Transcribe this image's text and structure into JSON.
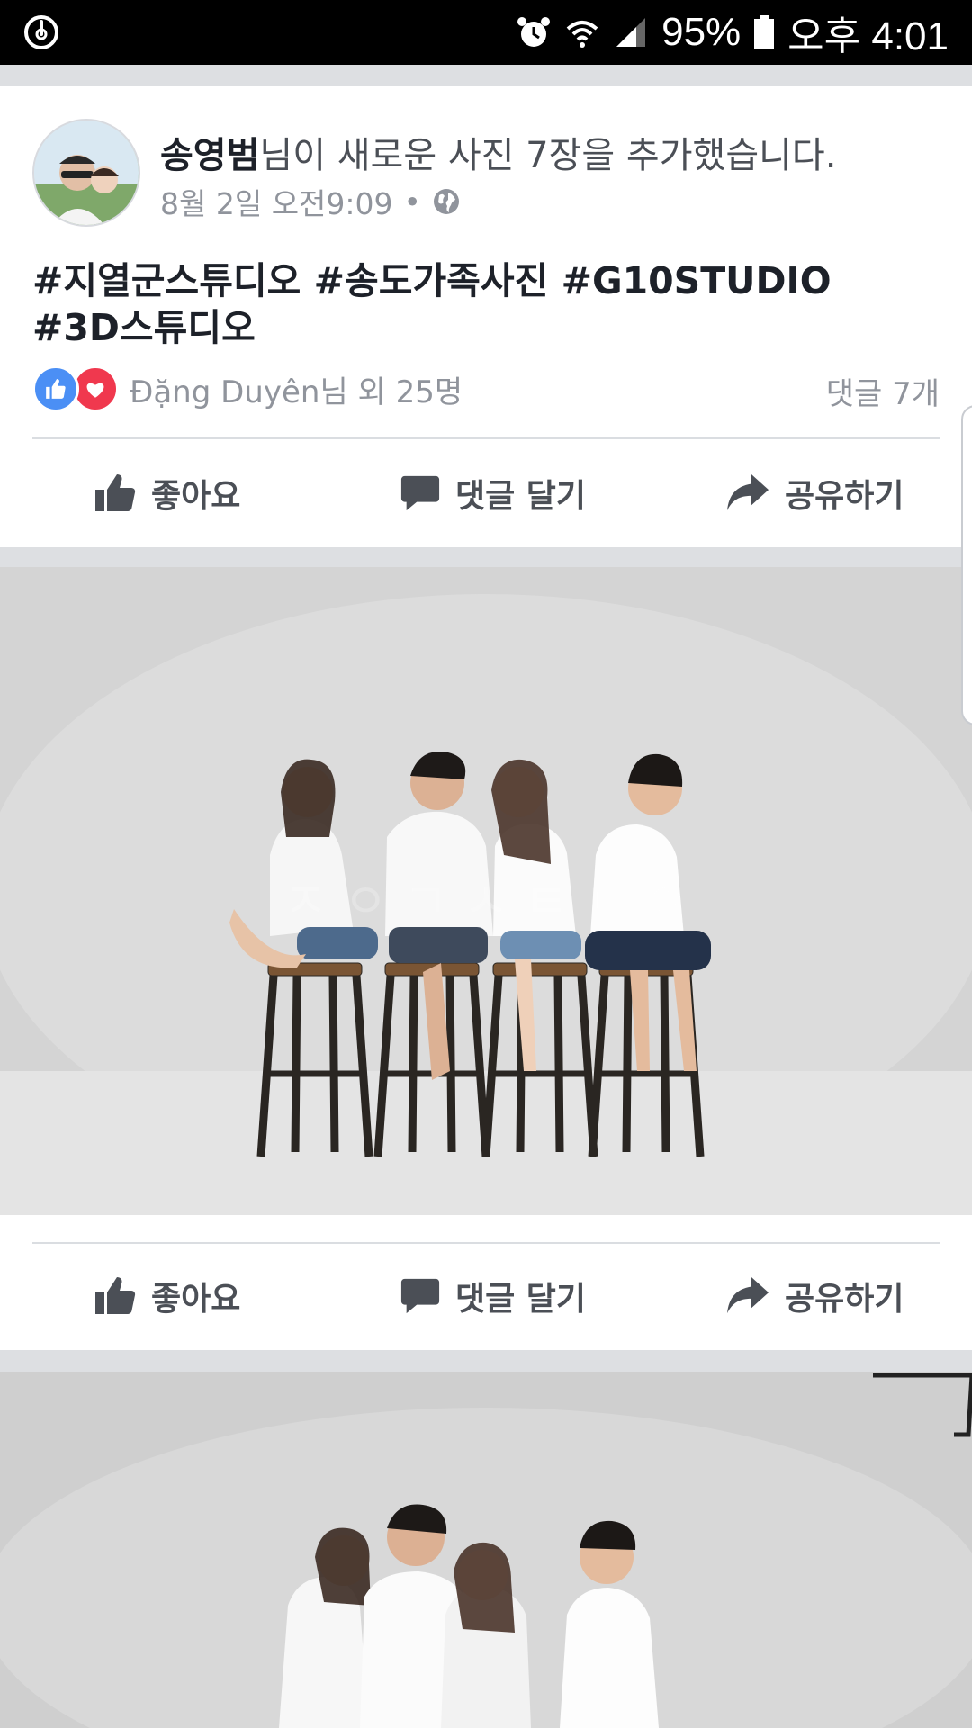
{
  "status_bar": {
    "left_icon": "power-sync-icon",
    "alarm_icon": "alarm-clock-icon",
    "wifi_icon": "wifi-icon",
    "signal_icon": "cell-signal-icon",
    "battery_percent": "95%",
    "battery_icon": "battery-icon",
    "time": "오후 4:01"
  },
  "post": {
    "author": "송영범",
    "headline_suffix": "님이 새로운 사진 7장을 추가했습니다.",
    "timestamp": "8월 2일 오전9:09",
    "separator": "•",
    "privacy_icon": "globe-icon",
    "hashtags_line1": "#지열군스튜디오 #송도가족사진 #G10STUDIO",
    "hashtags_line2": "#3D스튜디오",
    "reactions_text": "Đặng Duyên님 외 25명",
    "comments_count": "댓글 7개"
  },
  "actions": {
    "like": "좋아요",
    "comment": "댓글 달기",
    "share": "공유하기"
  },
  "colors": {
    "brand_like_blue": "#4b8ff5",
    "love_red": "#f0384e",
    "action_gray": "#4b4f56",
    "meta_gray": "#90949c"
  }
}
